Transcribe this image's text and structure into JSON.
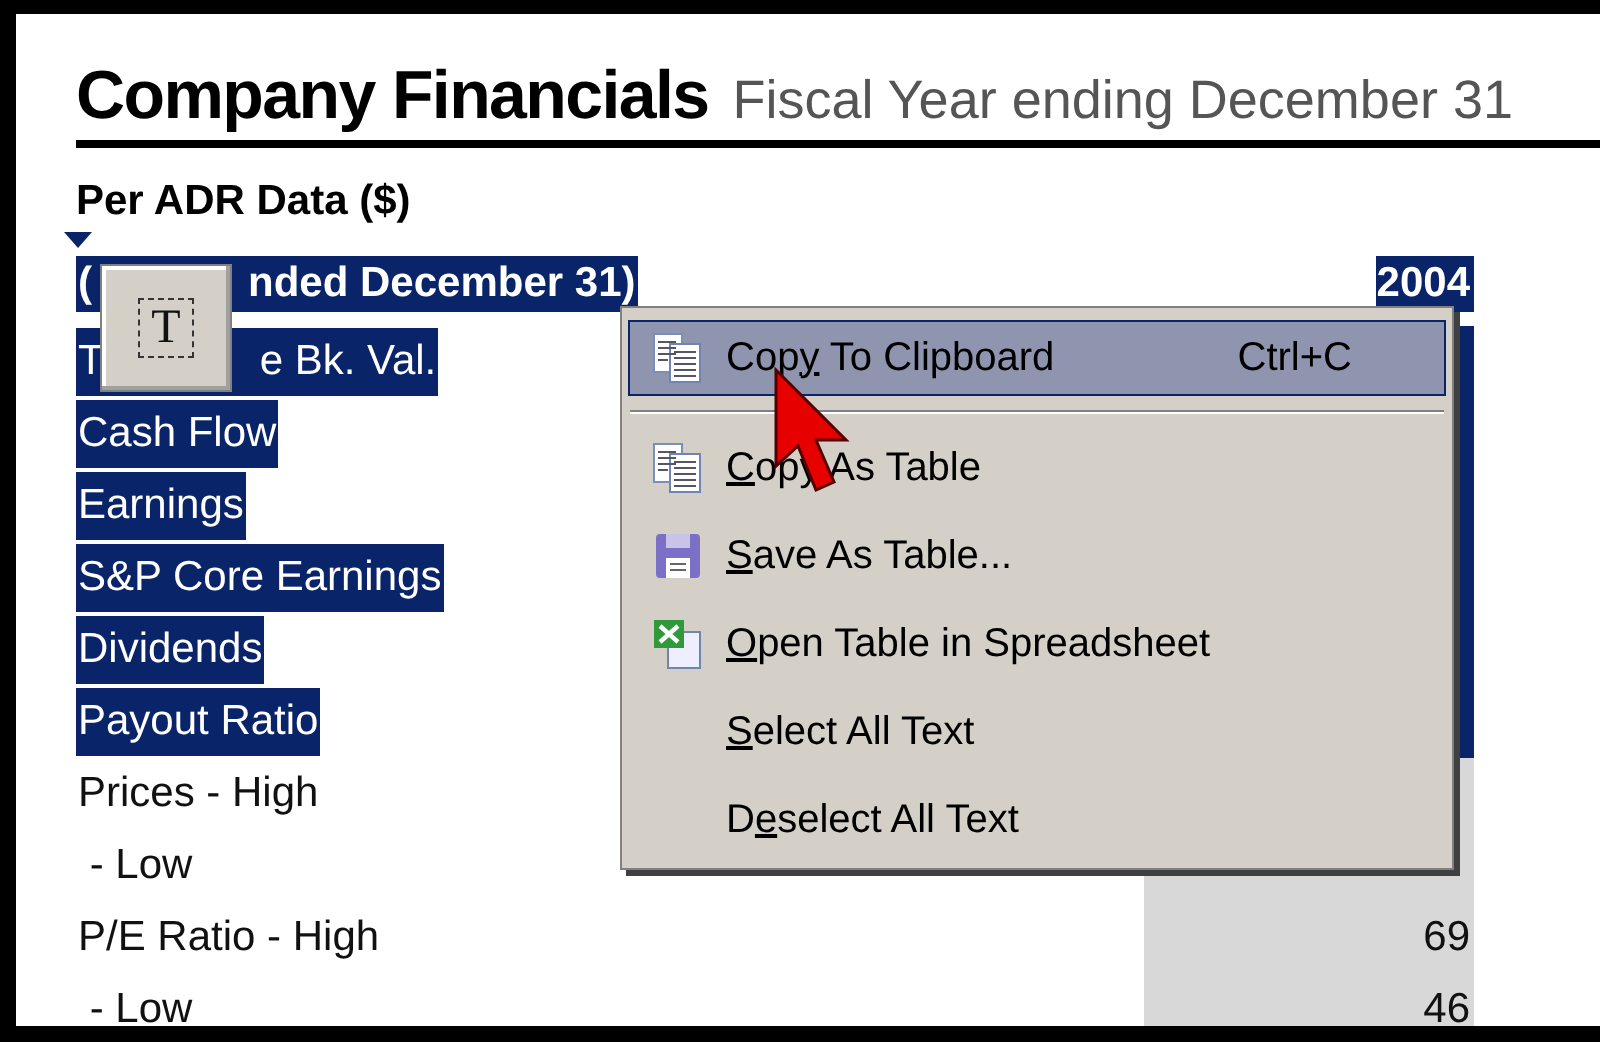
{
  "header": {
    "title": "Company Financials",
    "subtitle": "Fiscal Year ending December 31"
  },
  "section": {
    "title": "Per ADR Data ($)"
  },
  "table": {
    "rows": [
      {
        "kind": "header",
        "label": [
          "(",
          "nded December 31)"
        ],
        "value": "2004",
        "selected": true
      },
      {
        "kind": "data",
        "label": [
          "T",
          "e Bk. Val."
        ],
        "selected": true
      },
      {
        "kind": "data",
        "label": [
          "Cash Flow"
        ],
        "selected": true
      },
      {
        "kind": "data",
        "label": [
          "Earnings"
        ],
        "selected": true
      },
      {
        "kind": "data",
        "label": [
          "S&P Core Earnings"
        ],
        "selected": true
      },
      {
        "kind": "data",
        "label": [
          "Dividends"
        ],
        "selected": true
      },
      {
        "kind": "data",
        "label": [
          "Payout Ratio"
        ],
        "selected": true
      },
      {
        "kind": "data",
        "label": [
          "Prices - High"
        ],
        "selected": false
      },
      {
        "kind": "data",
        "label": [
          " - Low"
        ],
        "selected": false
      },
      {
        "kind": "data",
        "label": [
          "P/E Ratio - High"
        ],
        "value": "69",
        "selected": false
      },
      {
        "kind": "data",
        "label": [
          " - Low"
        ],
        "value": "46",
        "selected": false
      }
    ]
  },
  "text_tool": {
    "glyph": "T"
  },
  "context_menu": {
    "items": [
      {
        "kind": "copy",
        "label": {
          "pre": "Cop",
          "key": "y",
          "post": " To Clipboard"
        },
        "shortcut": "Ctrl+C",
        "selected": true,
        "separator_after": true
      },
      {
        "kind": "copy",
        "label": {
          "key": "C",
          "post": "opy As Table"
        },
        "selected": false,
        "separator_after": false
      },
      {
        "kind": "save",
        "label": {
          "key": "S",
          "post": "ave As Table..."
        },
        "selected": false,
        "separator_after": false
      },
      {
        "kind": "spreadsheet",
        "label": {
          "key": "O",
          "post": "pen Table in Spreadsheet"
        },
        "selected": false,
        "separator_after": false
      },
      {
        "kind": "plain",
        "label": {
          "key": "S",
          "post": "elect All Text"
        },
        "selected": false,
        "separator_after": false
      },
      {
        "kind": "plain",
        "label": {
          "pre": "D",
          "key": "e",
          "post": "select All Text"
        },
        "selected": false,
        "separator_after": false
      }
    ]
  }
}
